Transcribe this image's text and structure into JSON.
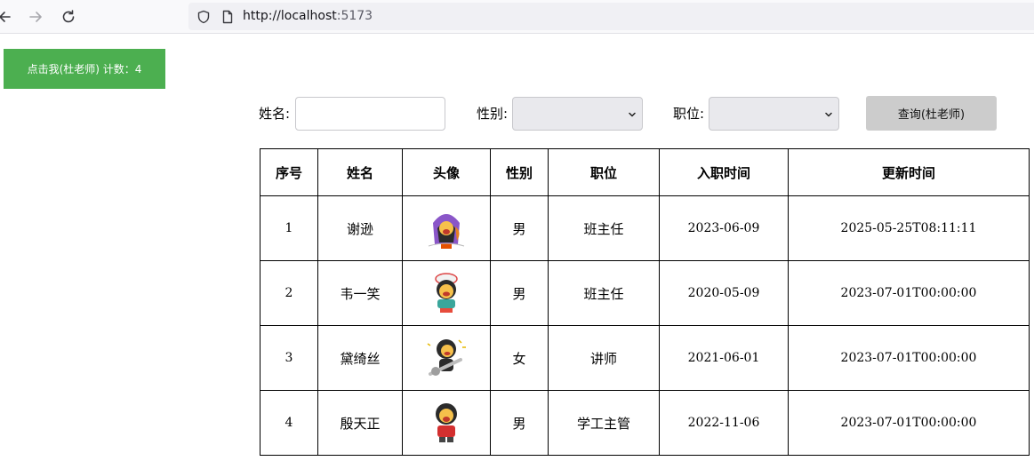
{
  "browser": {
    "url_host": "http://localhost",
    "url_port": ":5173"
  },
  "counter_button": {
    "label": "点击我(杜老师) 计数：4"
  },
  "search": {
    "name_label": "姓名:",
    "name_value": "",
    "gender_label": "性别:",
    "gender_value": "",
    "position_label": "职位:",
    "position_value": "",
    "query_label": "查询(杜老师)"
  },
  "table": {
    "headers": [
      "序号",
      "姓名",
      "头像",
      "性别",
      "职位",
      "入职时间",
      "更新时间"
    ],
    "rows": [
      {
        "index": "1",
        "name": "谢逊",
        "avatar": "monkey-hoodie-avatar",
        "gender": "男",
        "position": "班主任",
        "entry_date": "2023-06-09",
        "update_time": "2025-05-25T08:11:11"
      },
      {
        "index": "2",
        "name": "韦一笑",
        "avatar": "monkey-cap-avatar",
        "gender": "男",
        "position": "班主任",
        "entry_date": "2020-05-09",
        "update_time": "2023-07-01T00:00:00"
      },
      {
        "index": "3",
        "name": "黛绮丝",
        "avatar": "monkey-guitar-avatar",
        "gender": "女",
        "position": "讲师",
        "entry_date": "2021-06-01",
        "update_time": "2023-07-01T00:00:00"
      },
      {
        "index": "4",
        "name": "殷天正",
        "avatar": "monkey-red-shirt-avatar",
        "gender": "男",
        "position": "学工主管",
        "entry_date": "2022-11-06",
        "update_time": "2023-07-01T00:00:00"
      }
    ]
  },
  "colors": {
    "counter_green": "#4caf50",
    "query_gray": "#cccccc",
    "select_bg": "#e9e9ed"
  }
}
